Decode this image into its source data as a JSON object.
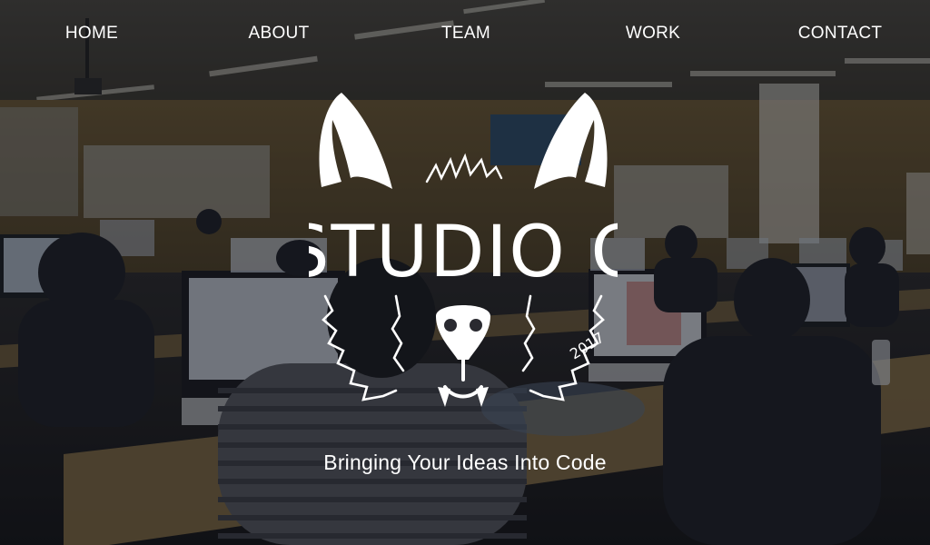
{
  "nav": {
    "items": [
      {
        "label": "HOME"
      },
      {
        "label": "ABOUT"
      },
      {
        "label": "TEAM"
      },
      {
        "label": "WORK"
      },
      {
        "label": "CONTACT"
      }
    ]
  },
  "hero": {
    "logo_text": "STUDIO C",
    "logo_year": "2017",
    "tagline": "Bringing Your Ideas Into Code"
  },
  "colors": {
    "text": "#ffffff",
    "overlay": "#0a0c12",
    "ceiling": "#3e3a33",
    "wall": "#5b4a2c",
    "desk": "#8c7449"
  },
  "icons": {
    "logo": "fox-head-icon"
  }
}
